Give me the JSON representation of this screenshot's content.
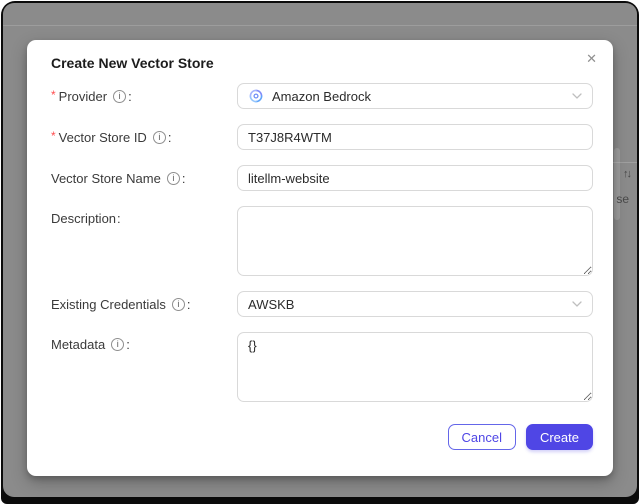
{
  "background": {
    "sort_icon": "↑↓",
    "clipped_text": "se"
  },
  "modal": {
    "title": "Create New Vector Store",
    "close_icon": "✕",
    "required_marker": "*",
    "colon": ":",
    "info_icon_glyph": "i",
    "fields": {
      "provider": {
        "label": "Provider",
        "value": "Amazon Bedrock",
        "icon": "bedrock-swirl-icon"
      },
      "vector_store_id": {
        "label": "Vector Store ID",
        "value": "T37J8R4WTM"
      },
      "vector_store_name": {
        "label": "Vector Store Name",
        "value": "litellm-website"
      },
      "description": {
        "label": "Description",
        "value": ""
      },
      "existing_credentials": {
        "label": "Existing Credentials",
        "value": "AWSKB"
      },
      "metadata": {
        "label": "Metadata",
        "value": "{}"
      }
    },
    "footer": {
      "cancel_label": "Cancel",
      "create_label": "Create"
    }
  },
  "colors": {
    "accent_indigo": "#4f46e5",
    "required_red": "#ff4d4f",
    "mask_gray": "#8b8b8b",
    "input_border": "#d9d9d9"
  }
}
